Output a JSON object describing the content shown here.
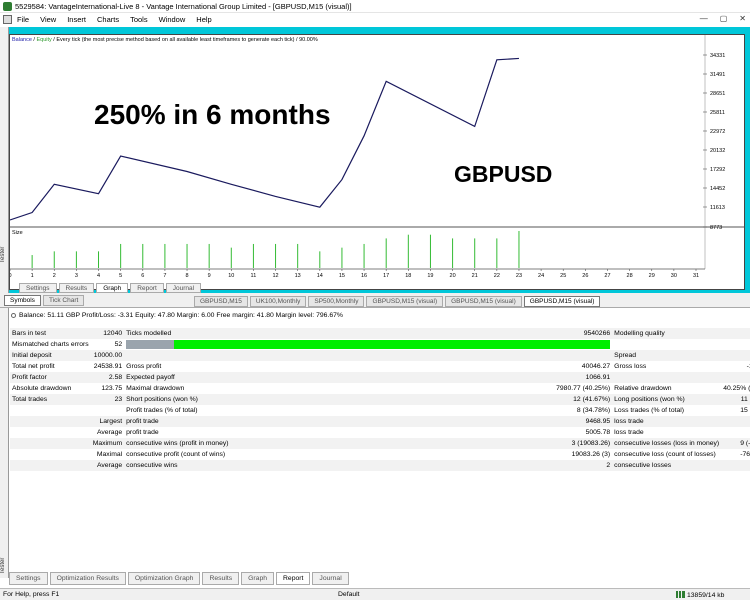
{
  "window": {
    "title": "5529584: VantageInternational-Live 8 - Vantage International Group Limited - [GBPUSD,M15 (visual)]",
    "controls": [
      "—",
      "▢",
      "✕"
    ]
  },
  "menu": [
    "File",
    "View",
    "Insert",
    "Charts",
    "Tools",
    "Window",
    "Help"
  ],
  "chart": {
    "header_balance": "Balance",
    "header_sep": " / ",
    "header_equity": "Equity",
    "header_rest": " / Every tick (the most precise method based on all available least timeframes to generate each tick) / 90.00%",
    "headline": "250% in 6 months",
    "symbol": "GBPUSD",
    "size_label": "Size",
    "side_tab": "Tester",
    "tabs": [
      "Settings",
      "Results",
      "Graph",
      "Report",
      "Journal"
    ],
    "active_tab": "Graph"
  },
  "chart_data": {
    "type": "line",
    "series": [
      {
        "values": [
          10200,
          11300,
          15500,
          14100,
          19700,
          17400,
          15500,
          13700,
          12100,
          16200,
          22700,
          30800,
          24100,
          34000,
          34200
        ],
        "x": [
          0,
          1,
          2,
          4,
          5,
          8,
          10,
          12,
          14,
          15,
          16,
          17,
          21,
          22,
          23
        ]
      }
    ],
    "ylim": [
      9450,
      35900
    ],
    "y_ticks": [
      "34331",
      "31491",
      "28651",
      "25811",
      "22972",
      "20132",
      "17292",
      "14452",
      "11613",
      "8773"
    ],
    "x_ticks": [
      "0",
      "1",
      "2",
      "3",
      "4",
      "5",
      "6",
      "7",
      "8",
      "9",
      "10",
      "11",
      "12",
      "13",
      "14",
      "15",
      "16",
      "17",
      "18",
      "19",
      "20",
      "21",
      "22",
      "23",
      "24",
      "25",
      "26",
      "27",
      "28",
      "29",
      "30",
      "31"
    ],
    "size_bars": {
      "x": [
        1,
        2,
        3,
        4,
        5,
        6,
        7,
        8,
        9,
        10,
        11,
        12,
        13,
        14,
        15,
        16,
        17,
        18,
        19,
        20,
        21,
        22,
        23
      ],
      "values": [
        0.35,
        0.45,
        0.45,
        0.45,
        0.65,
        0.65,
        0.65,
        0.65,
        0.65,
        0.55,
        0.65,
        0.65,
        0.65,
        0.45,
        0.55,
        0.65,
        0.8,
        0.9,
        0.9,
        0.8,
        0.8,
        0.8,
        1.0
      ]
    }
  },
  "left_tabs": [
    "Symbols",
    "Tick Chart"
  ],
  "active_left_tab": "Symbols",
  "window_tabs": [
    "GBPUSD,M15",
    "UK100,Monthly",
    "SP500,Monthly",
    "GBPUSD,M15 (visual)",
    "GBPUSD,M15 (visual)",
    "GBPUSD,M15 (visual)"
  ],
  "active_window_tab": 5,
  "report": {
    "side_tab": "Tester",
    "balance_line": "Balance: 51.11 GBP  Profit/Loss: -3.31  Equity: 47.80  Margin: 6.00  Free margin: 41.80  Margin level: 796.67%",
    "rows": [
      [
        "Bars in test",
        "12040",
        "Ticks modelled",
        "9540266",
        "Modelling quality",
        "90.00%"
      ],
      [
        "Mismatched charts errors",
        "52",
        "",
        "",
        "",
        ""
      ],
      [
        "Initial deposit",
        "10000.00",
        "",
        "",
        "Spread",
        "30"
      ],
      [
        "Total net profit",
        "24538.91",
        "Gross profit",
        "40046.27",
        "Gross loss",
        "-15507.36"
      ],
      [
        "Profit factor",
        "2.58",
        "Expected payoff",
        "1066.91",
        "",
        ""
      ],
      [
        "Absolute drawdown",
        "123.75",
        "Maximal drawdown",
        "7980.77 (40.25%)",
        "Relative drawdown",
        "40.25% (7980.77)"
      ],
      [
        "Total trades",
        "23",
        "Short positions (won %)",
        "12 (41.67%)",
        "Long positions (won %)",
        "11 (27.27%)"
      ],
      [
        "",
        "",
        "Profit trades (% of total)",
        "8 (34.78%)",
        "Loss trades (% of total)",
        "15 (65.22%)"
      ],
      [
        "",
        "Largest",
        "profit trade",
        "9468.95",
        "loss trade",
        "-1664.10"
      ],
      [
        "",
        "Average",
        "profit trade",
        "5005.78",
        "loss trade",
        "-1033.82"
      ],
      [
        "",
        "Maximum",
        "consecutive wins (profit in money)",
        "3 (19083.26)",
        "consecutive losses (loss in money)",
        "9 (-7685.34)"
      ],
      [
        "",
        "Maximal",
        "consecutive profit (count of wins)",
        "19083.26 (3)",
        "consecutive loss (count of losses)",
        "-7685.34 (9)"
      ],
      [
        "",
        "Average",
        "consecutive wins",
        "2",
        "consecutive losses",
        "5"
      ]
    ],
    "quality_fraction": 0.9
  },
  "bottom_tabs": [
    "Settings",
    "Optimization Results",
    "Optimization Graph",
    "Results",
    "Graph",
    "Report",
    "Journal"
  ],
  "active_bottom_tab": "Report",
  "status": {
    "help": "For Help, press F1",
    "profile": "Default",
    "connection": "13859/14 kb"
  },
  "colors": {
    "frame": "#00c7d9",
    "line": "#1a1a5e",
    "bars": "#33bb33",
    "quality_bar": "#00ee00"
  }
}
